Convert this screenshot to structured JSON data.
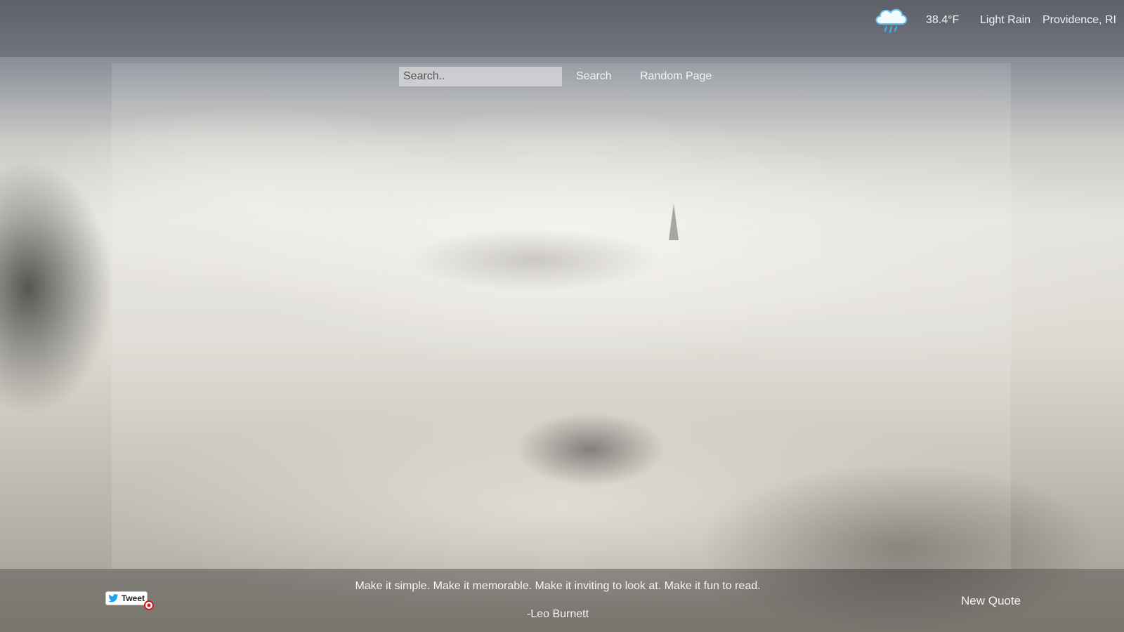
{
  "weather": {
    "icon": "cloud-rain-icon",
    "temperature": "38.4°F",
    "condition": "Light Rain",
    "location": "Providence, RI"
  },
  "search": {
    "placeholder": "Search..",
    "value": "",
    "button_label": "Search"
  },
  "nav": {
    "random_label": "Random Page"
  },
  "quote": {
    "text": "Make it simple. Make it memorable. Make it inviting to look at. Make it fun to read.",
    "author": "-Leo Burnett",
    "tweet_label": "Tweet",
    "new_quote_label": "New Quote"
  },
  "colors": {
    "text": "#f4f4f4",
    "weather_icon": "#6ec6f0",
    "tweet_bird": "#1da1f2"
  }
}
